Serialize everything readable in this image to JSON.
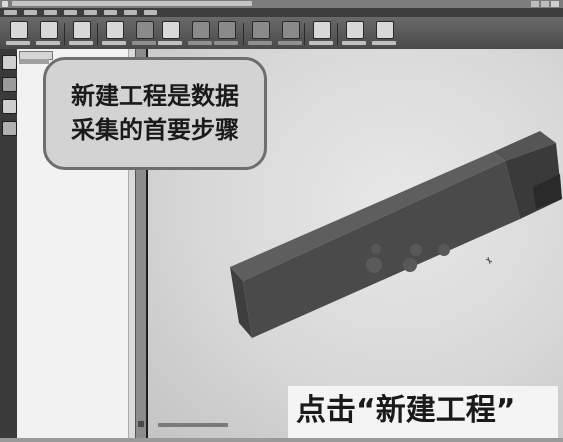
{
  "overlay_caption": {
    "line1": "新建工程是数据",
    "line2": "采集的首要步骤"
  },
  "bottom_caption": "点击“新建工程”"
}
